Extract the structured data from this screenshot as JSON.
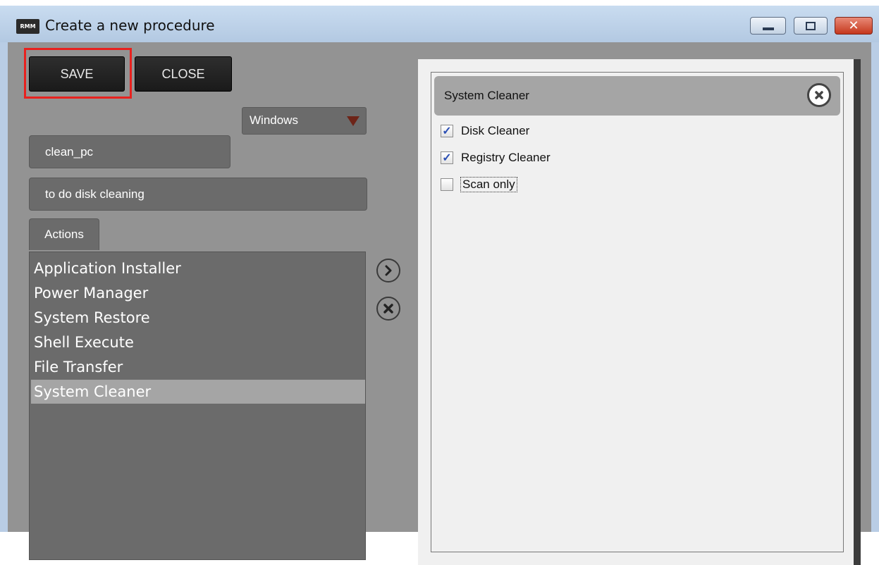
{
  "window": {
    "title": "Create a new procedure",
    "app_icon_label": "RMM",
    "close_glyph": "✕"
  },
  "toolbar": {
    "save_label": "SAVE",
    "close_label": "CLOSE"
  },
  "form": {
    "name_value": "clean_pc",
    "os_selected": "Windows",
    "description_value": "to do disk cleaning"
  },
  "actions": {
    "tab_label": "Actions",
    "items": [
      {
        "label": "Application Installer",
        "selected": false
      },
      {
        "label": "Power Manager",
        "selected": false
      },
      {
        "label": "System Restore",
        "selected": false
      },
      {
        "label": "Shell Execute",
        "selected": false
      },
      {
        "label": "File Transfer",
        "selected": false
      },
      {
        "label": "System Cleaner",
        "selected": true
      }
    ]
  },
  "controls": {
    "add_icon": "chevron-right-icon",
    "remove_icon": "x-circle-icon"
  },
  "procedure": {
    "section_title": "System Cleaner",
    "options": [
      {
        "label": "Disk Cleaner",
        "checked": true
      },
      {
        "label": "Registry Cleaner",
        "checked": true
      },
      {
        "label": "Scan only",
        "checked": false
      }
    ]
  },
  "colors": {
    "highlight": "#e8211e",
    "checkmark": "#2c4fb4"
  }
}
